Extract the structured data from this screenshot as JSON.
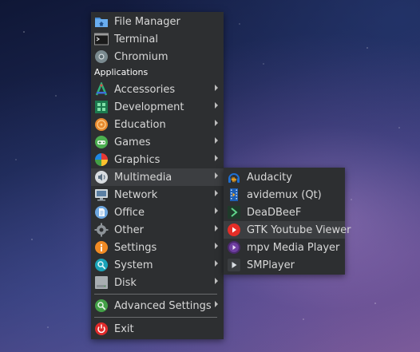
{
  "menu": {
    "top_items": [
      {
        "label": "File Manager",
        "icon": "folder-home-icon"
      },
      {
        "label": "Terminal",
        "icon": "terminal-icon"
      },
      {
        "label": "Chromium",
        "icon": "chromium-icon"
      }
    ],
    "section_header": "Applications",
    "categories": [
      {
        "label": "Accessories",
        "icon": "accessories-icon"
      },
      {
        "label": "Development",
        "icon": "development-icon"
      },
      {
        "label": "Education",
        "icon": "education-icon"
      },
      {
        "label": "Games",
        "icon": "games-icon"
      },
      {
        "label": "Graphics",
        "icon": "graphics-icon"
      },
      {
        "label": "Multimedia",
        "icon": "multimedia-icon"
      },
      {
        "label": "Network",
        "icon": "network-icon"
      },
      {
        "label": "Office",
        "icon": "office-icon"
      },
      {
        "label": "Other",
        "icon": "other-icon"
      },
      {
        "label": "Settings",
        "icon": "settings-icon"
      },
      {
        "label": "System",
        "icon": "system-icon"
      },
      {
        "label": "Disk",
        "icon": "disk-icon"
      }
    ],
    "advanced_settings": "Advanced Settings",
    "exit": "Exit"
  },
  "submenu": {
    "items": [
      {
        "label": "Audacity",
        "icon": "audacity-icon"
      },
      {
        "label": "avidemux (Qt)",
        "icon": "avidemux-icon"
      },
      {
        "label": "DeaDBeeF",
        "icon": "deadbeef-icon"
      },
      {
        "label": "GTK Youtube Viewer",
        "icon": "youtube-icon"
      },
      {
        "label": "mpv Media Player",
        "icon": "mpv-icon"
      },
      {
        "label": "SMPlayer",
        "icon": "smplayer-icon"
      }
    ]
  },
  "colors": {
    "menu_bg": "#2d2f31",
    "highlight_bg": "#3c3e41",
    "text": "#d8d8d8",
    "exit_red": "#e02b2b"
  }
}
